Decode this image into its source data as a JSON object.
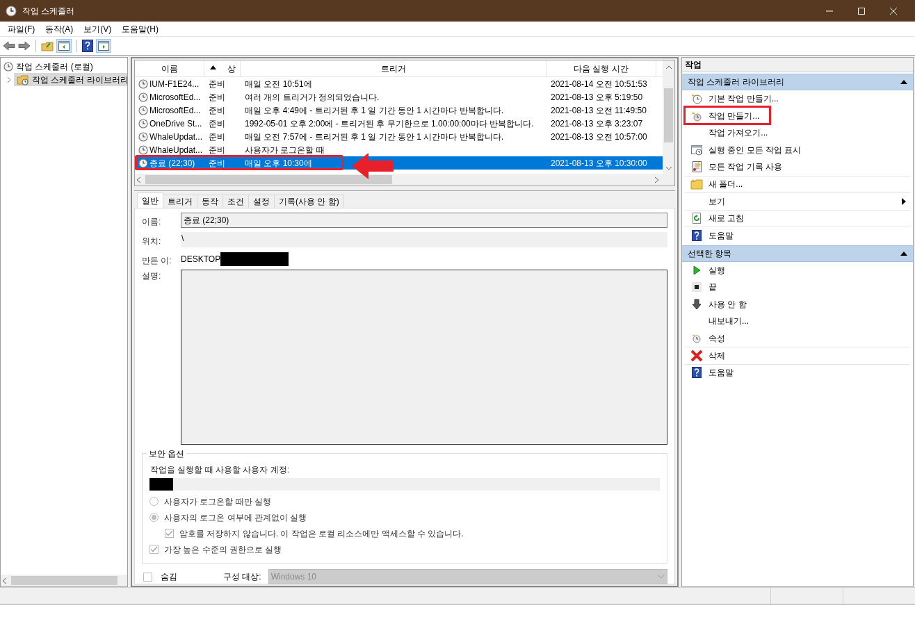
{
  "window": {
    "title": "작업 스케줄러"
  },
  "menu": [
    "파일(F)",
    "동작(A)",
    "보기(V)",
    "도움말(H)"
  ],
  "tree": [
    {
      "label": "작업 스케줄러 (로컬)",
      "selected": false,
      "children": [
        {
          "label": "작업 스케줄러 라이브러리",
          "selected": true
        }
      ]
    }
  ],
  "task_list": {
    "columns": [
      {
        "label": "이름",
        "sorted": false
      },
      {
        "label": "상",
        "sorted": true
      },
      {
        "label": "트리거",
        "sorted": false
      },
      {
        "label": "다음 실행 시간",
        "sorted": false
      }
    ],
    "rows": [
      {
        "name": "IUM-F1E24...",
        "status": "준비",
        "trigger": "매일 오전 10:51에",
        "next_run": "2021-08-14 오전 10:51:53",
        "selected": false
      },
      {
        "name": "MicrosoftEd...",
        "status": "준비",
        "trigger": "여러 개의 트리거가 정의되었습니다.",
        "next_run": "2021-08-13 오후 5:19:50",
        "selected": false
      },
      {
        "name": "MicrosoftEd...",
        "status": "준비",
        "trigger": "매일 오후 4:49에 - 트리거된 후 1 일 기간 동안 1 시간마다 반복합니다.",
        "next_run": "2021-08-13 오전 11:49:50",
        "selected": false
      },
      {
        "name": "OneDrive St...",
        "status": "준비",
        "trigger": "1992-05-01 오후 2:00에 - 트리거된 후 무기한으로 1.00:00:00마다 반복합니다.",
        "next_run": "2021-08-13 오후 3:23:07",
        "selected": false
      },
      {
        "name": "WhaleUpdat...",
        "status": "준비",
        "trigger": "매일 오전 7:57에 - 트리거된 후 1 일 기간 동안 1 시간마다 반복합니다.",
        "next_run": "2021-08-13 오전 10:57:00",
        "selected": false
      },
      {
        "name": "WhaleUpdat...",
        "status": "준비",
        "trigger": "사용자가 로그온할 때",
        "next_run": "",
        "selected": false
      },
      {
        "name": "종료 (22;30)",
        "status": "준비",
        "trigger": "매일 오후 10:30에",
        "next_run": "2021-08-13 오후 10:30:00",
        "selected": true
      }
    ]
  },
  "detail_tabs": [
    {
      "label": "일반",
      "selected": true
    },
    {
      "label": "트리거",
      "selected": false
    },
    {
      "label": "동작",
      "selected": false
    },
    {
      "label": "조건",
      "selected": false
    },
    {
      "label": "설정",
      "selected": false
    },
    {
      "label": "기록(사용 안 함)",
      "selected": false
    }
  ],
  "general": {
    "name_label": "이름:",
    "name_value": "종료 (22;30)",
    "location_label": "위치:",
    "location_value": "\\",
    "author_label": "만든 이:",
    "author_value": "DESKTOP",
    "description_label": "설명:"
  },
  "security": {
    "title": "보안 옵션",
    "account_label": "작업을 실행할 때 사용할 사용자 계정:",
    "options": [
      {
        "kind": "radio",
        "label": "사용자가 로그온할 때만 실행",
        "selected": false
      },
      {
        "kind": "radio",
        "label": "사용자의 로그온 여부에 관계없이 실행",
        "selected": true,
        "children": [
          {
            "kind": "checkbox",
            "label": "암호를 저장하지 않습니다. 이 작업은 로컬 리소스에만 액세스할 수 있습니다.",
            "checked": true
          }
        ]
      },
      {
        "kind": "checkbox",
        "label": "가장 높은 수준의 권한으로 실행",
        "checked": true
      }
    ]
  },
  "hidden": {
    "label": "숨김",
    "checked": false
  },
  "configure": {
    "label": "구성 대상:",
    "value": "Windows 10"
  },
  "actions": {
    "title": "작업",
    "sections": [
      {
        "title": "작업 스케줄러 라이브러리",
        "expanded": true,
        "items": [
          {
            "label": "기본 작업 만들기...",
            "submenu": false
          },
          {
            "label": "작업 만들기...",
            "submenu": false
          },
          {
            "label": "작업 가져오기...",
            "submenu": false
          },
          {
            "label": "실행 중인 모든 작업 표시",
            "submenu": false
          },
          {
            "label": "모든 작업 기록 사용",
            "submenu": false
          },
          {
            "label": "새 폴더...",
            "submenu": false
          },
          {
            "label": "보기",
            "submenu": true
          },
          {
            "label": "새로 고침",
            "submenu": false
          },
          {
            "label": "도움말",
            "submenu": false
          }
        ]
      },
      {
        "title": "선택한 항목",
        "expanded": true,
        "items": [
          {
            "label": "실행",
            "submenu": false
          },
          {
            "label": "끝",
            "submenu": false
          },
          {
            "label": "사용 안 함",
            "submenu": false
          },
          {
            "label": "내보내기...",
            "submenu": false
          },
          {
            "label": "속성",
            "submenu": false
          },
          {
            "label": "삭제",
            "submenu": false
          },
          {
            "label": "도움말",
            "submenu": false
          }
        ]
      }
    ]
  }
}
